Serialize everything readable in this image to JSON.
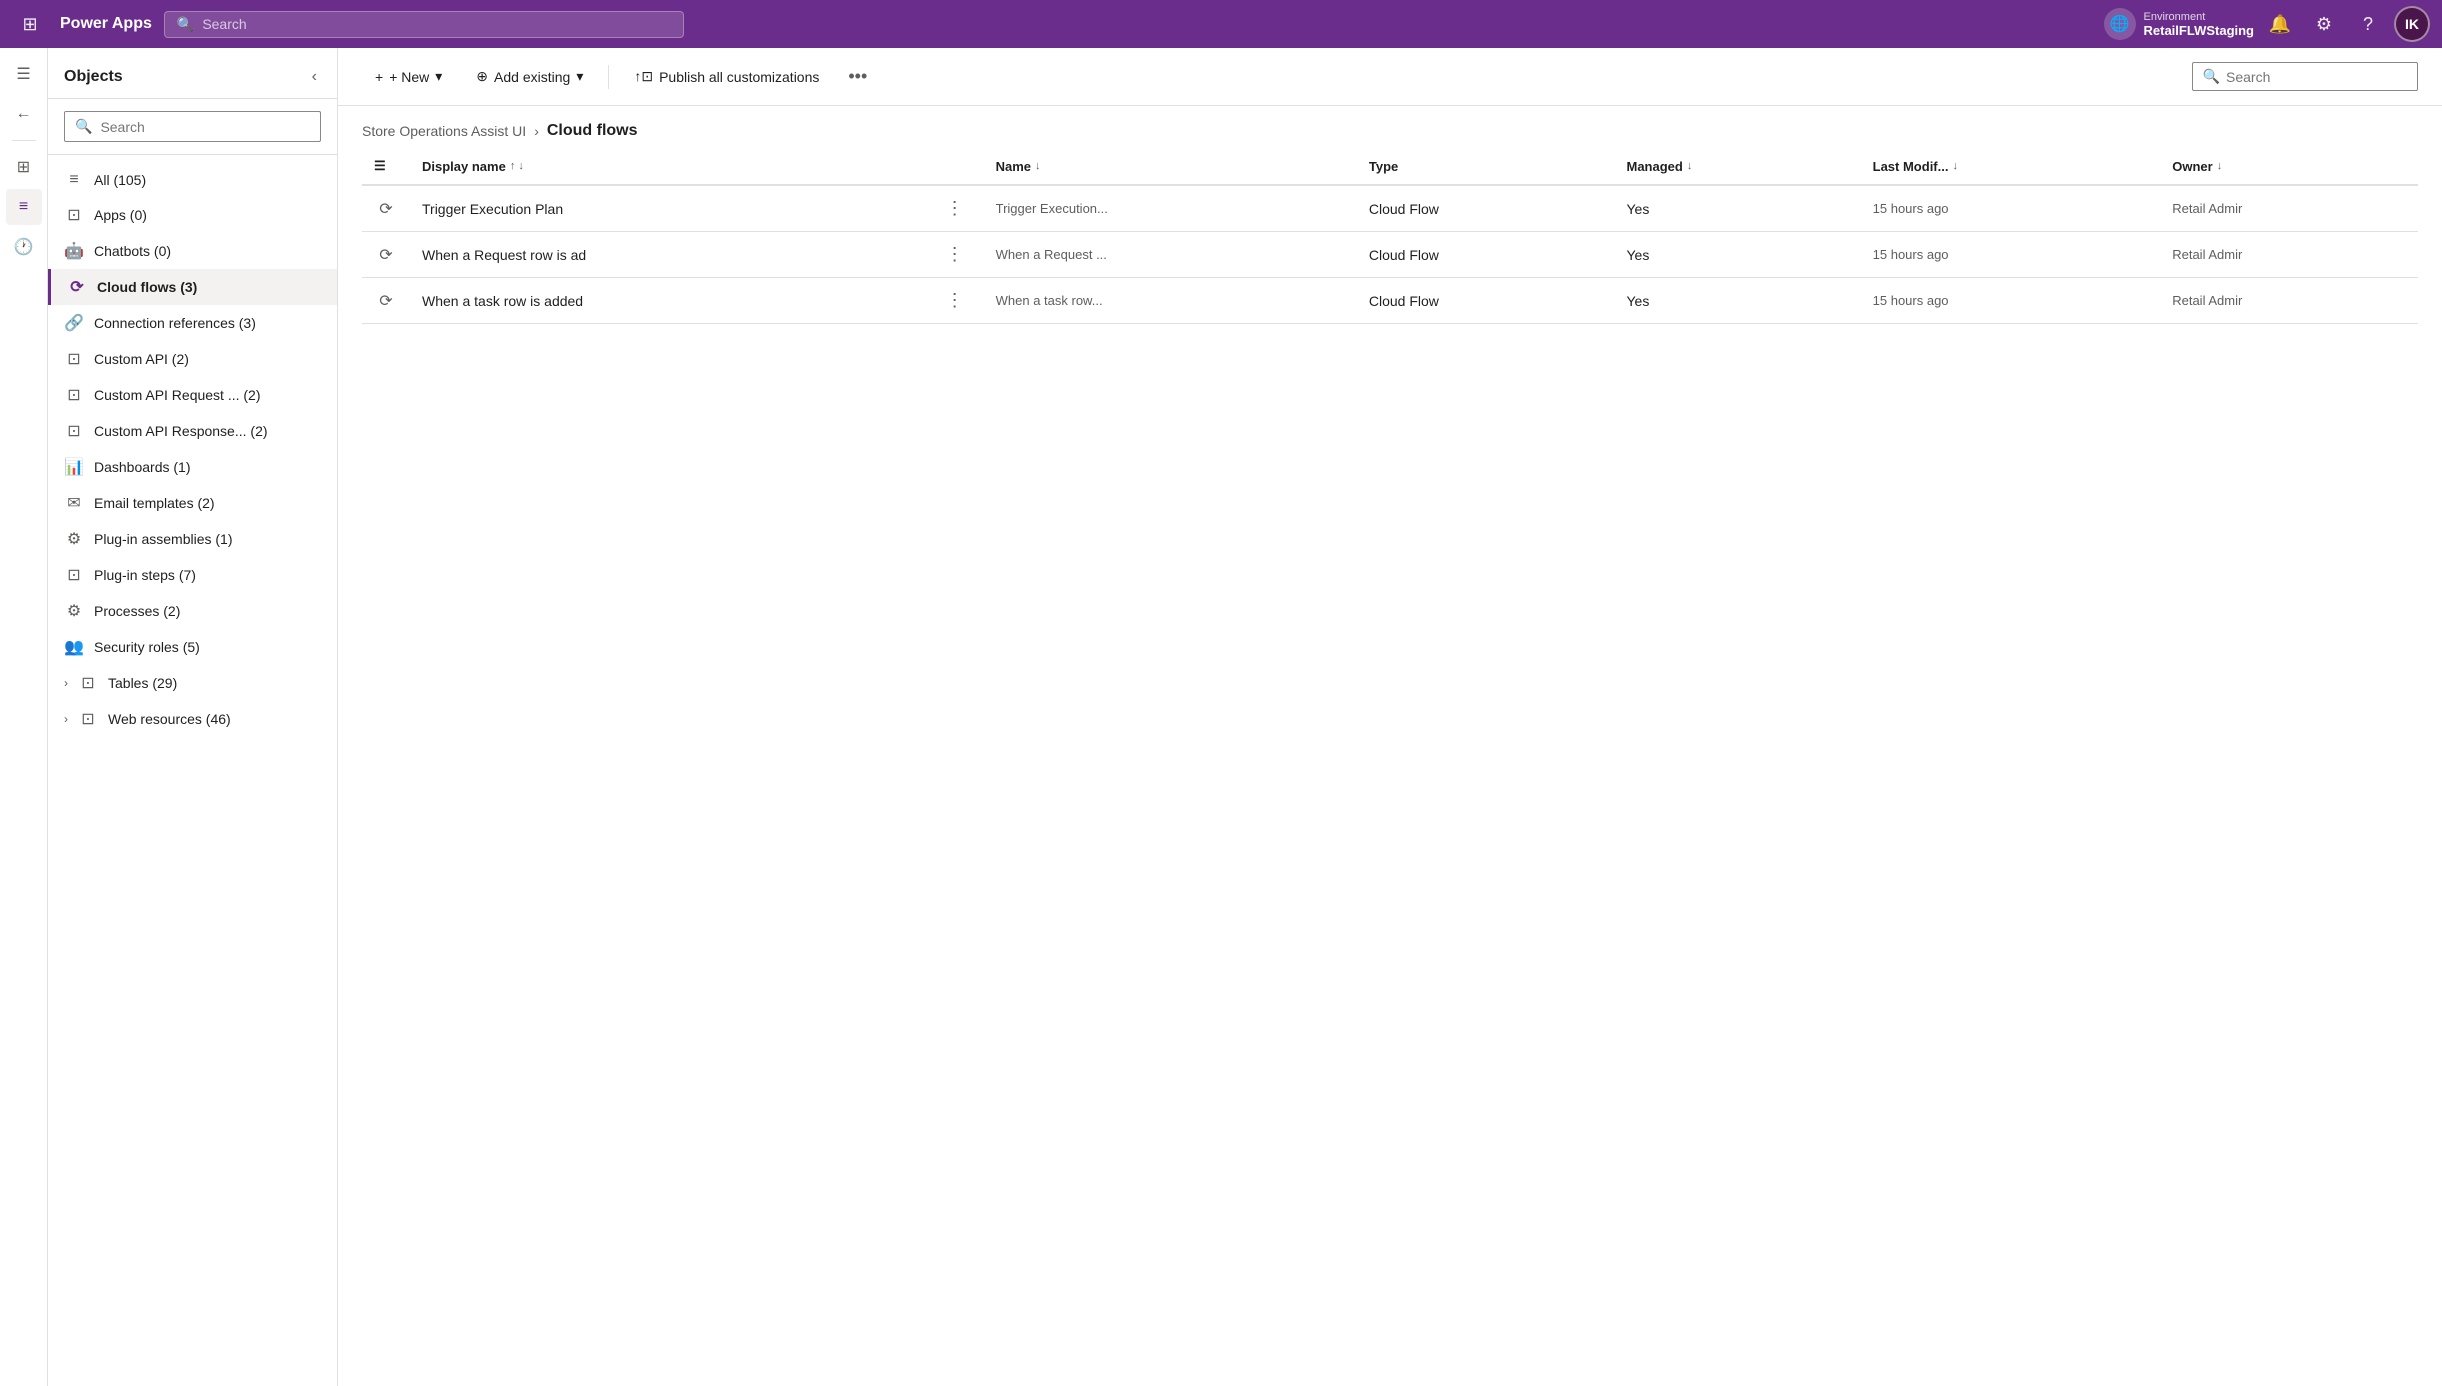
{
  "topNav": {
    "gridIconLabel": "⊞",
    "brand": "Power Apps",
    "searchPlaceholder": "Search",
    "environment": {
      "label": "Environment",
      "name": "RetailFLWStaging"
    },
    "bellIcon": "🔔",
    "settingsIcon": "⚙",
    "helpIcon": "?",
    "avatarInitials": "IK"
  },
  "iconBar": {
    "items": [
      {
        "icon": "☰",
        "name": "menu",
        "active": false
      },
      {
        "icon": "←",
        "name": "back",
        "active": false
      },
      {
        "icon": "•••",
        "name": "more-vert",
        "active": false
      },
      {
        "icon": "⊞",
        "name": "components",
        "active": false
      },
      {
        "icon": "≡",
        "name": "objects",
        "active": true
      }
    ]
  },
  "sidebar": {
    "title": "Objects",
    "collapseLabel": "‹",
    "searchPlaceholder": "Search",
    "items": [
      {
        "icon": "≡",
        "label": "All",
        "count": 105,
        "active": false,
        "expandable": false
      },
      {
        "icon": "⊡",
        "label": "Apps",
        "count": 0,
        "active": false,
        "expandable": false
      },
      {
        "icon": "🤖",
        "label": "Chatbots",
        "count": 0,
        "active": false,
        "expandable": false
      },
      {
        "icon": "⟳",
        "label": "Cloud flows",
        "count": 3,
        "active": true,
        "expandable": false
      },
      {
        "icon": "🔗",
        "label": "Connection references",
        "count": 3,
        "active": false,
        "expandable": false
      },
      {
        "icon": "⊡",
        "label": "Custom API",
        "count": 2,
        "active": false,
        "expandable": false
      },
      {
        "icon": "⊡",
        "label": "Custom API Request ...",
        "count": 2,
        "active": false,
        "expandable": false
      },
      {
        "icon": "⊡",
        "label": "Custom API Response...",
        "count": 2,
        "active": false,
        "expandable": false
      },
      {
        "icon": "📊",
        "label": "Dashboards",
        "count": 1,
        "active": false,
        "expandable": false
      },
      {
        "icon": "✉",
        "label": "Email templates",
        "count": 2,
        "active": false,
        "expandable": false
      },
      {
        "icon": "⚙",
        "label": "Plug-in assemblies",
        "count": 1,
        "active": false,
        "expandable": false
      },
      {
        "icon": "⊡",
        "label": "Plug-in steps",
        "count": 7,
        "active": false,
        "expandable": false
      },
      {
        "icon": "⚙",
        "label": "Processes",
        "count": 2,
        "active": false,
        "expandable": false
      },
      {
        "icon": "👥",
        "label": "Security roles",
        "count": 5,
        "active": false,
        "expandable": false
      },
      {
        "icon": "⊡",
        "label": "Tables",
        "count": 29,
        "active": false,
        "expandable": true
      },
      {
        "icon": "⊡",
        "label": "Web resources",
        "count": 46,
        "active": false,
        "expandable": true
      }
    ]
  },
  "toolbar": {
    "newLabel": "+ New",
    "newDropdownIcon": "▾",
    "addExistingLabel": "Add existing",
    "addExistingDropdownIcon": "▾",
    "addExistingIcon": "⊕",
    "publishLabel": "Publish all customizations",
    "publishIcon": "↑",
    "moreIcon": "•••",
    "searchPlaceholder": "Search",
    "searchIcon": "🔍"
  },
  "breadcrumb": {
    "parent": "Store Operations Assist UI",
    "separator": "›",
    "current": "Cloud flows"
  },
  "table": {
    "columns": [
      {
        "key": "displayName",
        "label": "Display name",
        "sortIcon": "↑↓",
        "hasSortIndicator": true
      },
      {
        "key": "name",
        "label": "Name",
        "sortIcon": "↓",
        "hasSortIndicator": true
      },
      {
        "key": "type",
        "label": "Type",
        "hasSortIndicator": false
      },
      {
        "key": "managed",
        "label": "Managed",
        "sortIcon": "↓",
        "hasSortIndicator": true
      },
      {
        "key": "lastModified",
        "label": "Last Modif...",
        "sortIcon": "↓",
        "hasSortIndicator": true
      },
      {
        "key": "owner",
        "label": "Owner",
        "sortIcon": "↓",
        "hasSortIndicator": true
      }
    ],
    "rows": [
      {
        "icon": "⟳",
        "displayName": "Trigger Execution Plan",
        "name": "Trigger Execution...",
        "type": "Cloud Flow",
        "managed": "Yes",
        "lastModified": "15 hours ago",
        "owner": "Retail Admir"
      },
      {
        "icon": "⟳",
        "displayName": "When a Request row is ad",
        "name": "When a Request ...",
        "type": "Cloud Flow",
        "managed": "Yes",
        "lastModified": "15 hours ago",
        "owner": "Retail Admir"
      },
      {
        "icon": "⟳",
        "displayName": "When a task row is added",
        "name": "When a task row...",
        "type": "Cloud Flow",
        "managed": "Yes",
        "lastModified": "15 hours ago",
        "owner": "Retail Admir"
      }
    ]
  }
}
